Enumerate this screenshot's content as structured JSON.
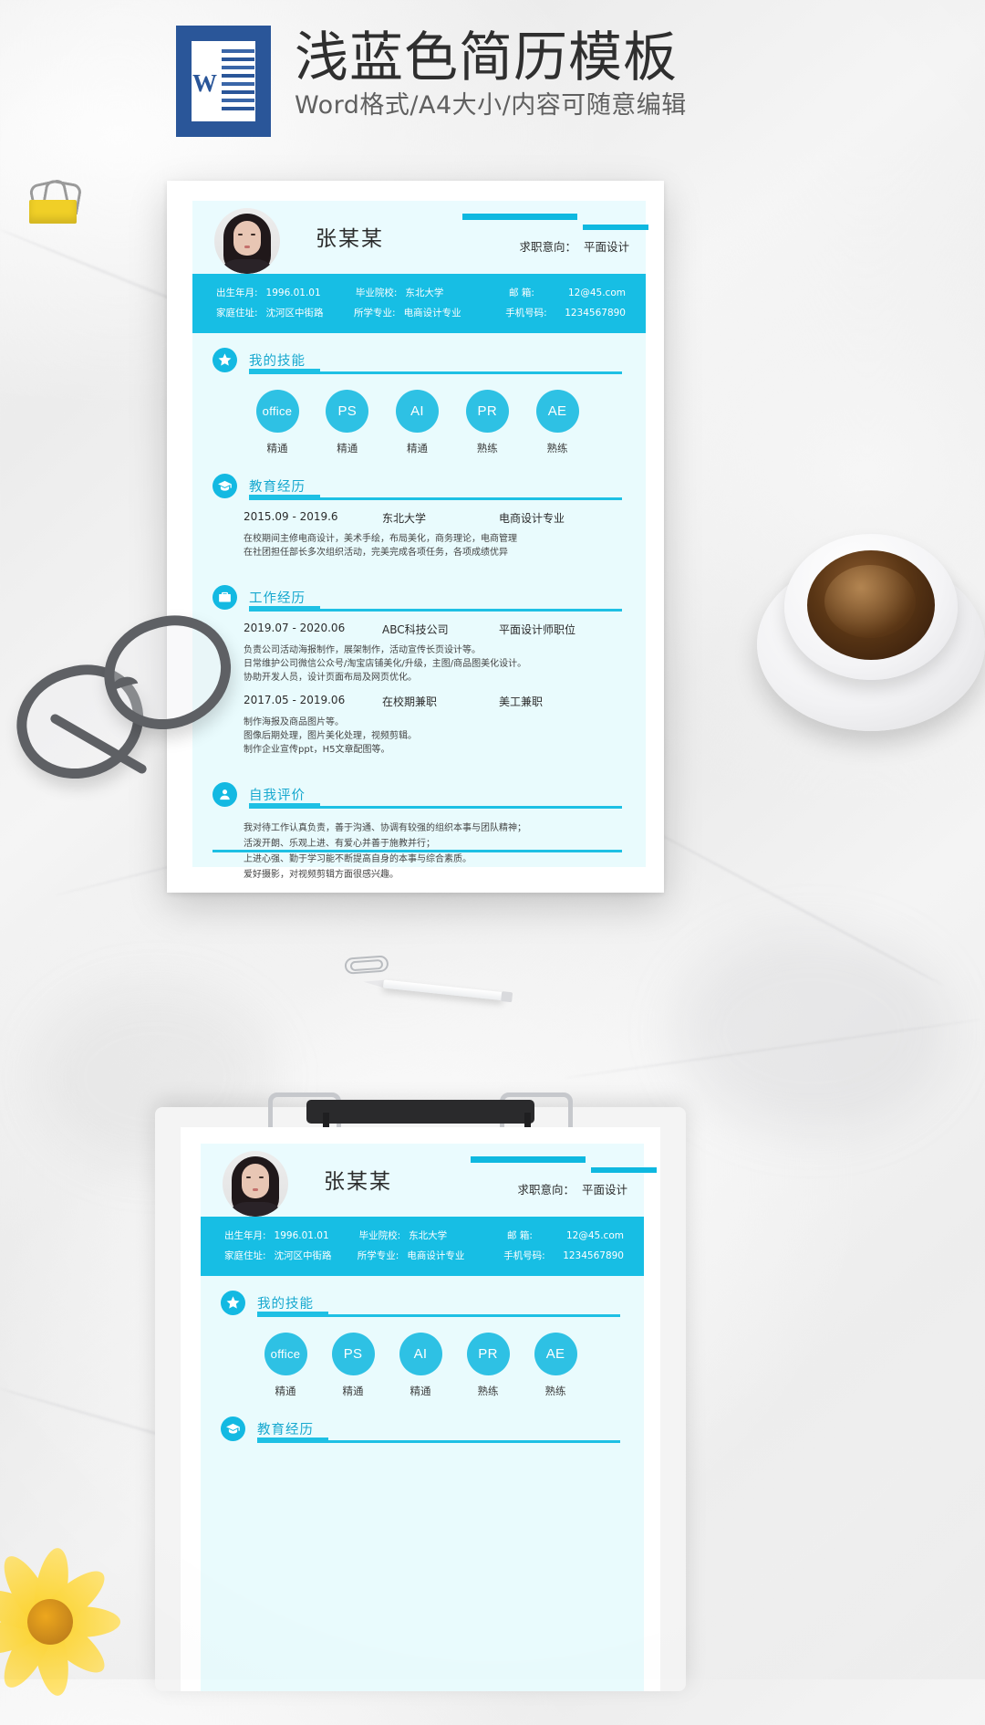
{
  "header": {
    "logo_letter": "W",
    "title": "浅蓝色简历模板",
    "subtitle": "Word格式/A4大小/内容可随意编辑"
  },
  "resume": {
    "name": "张某某",
    "objective_label": "求职意向：",
    "objective_value": "平面设计",
    "info": [
      [
        {
          "key": "出生年月:",
          "value": "1996.01.01"
        },
        {
          "key": "毕业院校:",
          "value": "东北大学"
        },
        {
          "key": "邮    箱:",
          "value": "12@45.com"
        }
      ],
      [
        {
          "key": "家庭住址:",
          "value": "沈河区中街路"
        },
        {
          "key": "所学专业:",
          "value": "电商设计专业"
        },
        {
          "key": "手机号码:",
          "value": "1234567890"
        }
      ]
    ],
    "sections": {
      "skills": {
        "title": "我的技能",
        "icon": "star-icon",
        "items": [
          {
            "name": "office",
            "level": "精通"
          },
          {
            "name": "PS",
            "level": "精通"
          },
          {
            "name": "AI",
            "level": "精通"
          },
          {
            "name": "PR",
            "level": "熟练"
          },
          {
            "name": "AE",
            "level": "熟练"
          }
        ]
      },
      "education": {
        "title": "教育经历",
        "icon": "graduation-cap-icon",
        "entries": [
          {
            "date": "2015.09 - 2019.6",
            "org": "东北大学",
            "role": "电商设计专业",
            "desc_lines": [
              "在校期间主修电商设计，美术手绘，布局美化，商务理论，电商管理",
              "在社团担任部长多次组织活动，完美完成各项任务，各项成绩优异"
            ]
          }
        ]
      },
      "work": {
        "title": "工作经历",
        "icon": "briefcase-icon",
        "entries": [
          {
            "date": "2019.07 - 2020.06",
            "org": "ABC科技公司",
            "role": "平面设计师职位",
            "desc_lines": [
              "负责公司活动海报制作，展架制作，活动宣传长页设计等。",
              "日常维护公司微信公众号/淘宝店铺美化/升级，主图/商品图美化设计。",
              "协助开发人员，设计页面布局及网页优化。"
            ]
          },
          {
            "date": "2017.05 - 2019.06",
            "org": "在校期兼职",
            "role": "美工兼职",
            "desc_lines": [
              "制作海报及商品图片等。",
              "图像后期处理，图片美化处理，视频剪辑。",
              "制作企业宣传ppt，H5文章配图等。"
            ]
          }
        ]
      },
      "summary": {
        "title": "自我评价",
        "icon": "person-icon",
        "lines": [
          "我对待工作认真负责，善于沟通、协调有较强的组织本事与团队精神；",
          "活泼开朗、乐观上进、有爱心并善于施教并行；",
          "上进心强、勤于学习能不断提高自身的本事与综合素质。",
          "爱好摄影，对视频剪辑方面很感兴趣。"
        ]
      }
    }
  },
  "colors": {
    "accent": "#17bee4",
    "accent_dark": "#17a8cf",
    "panel_bg": "#e9fbfd",
    "word_blue": "#2a5699"
  }
}
